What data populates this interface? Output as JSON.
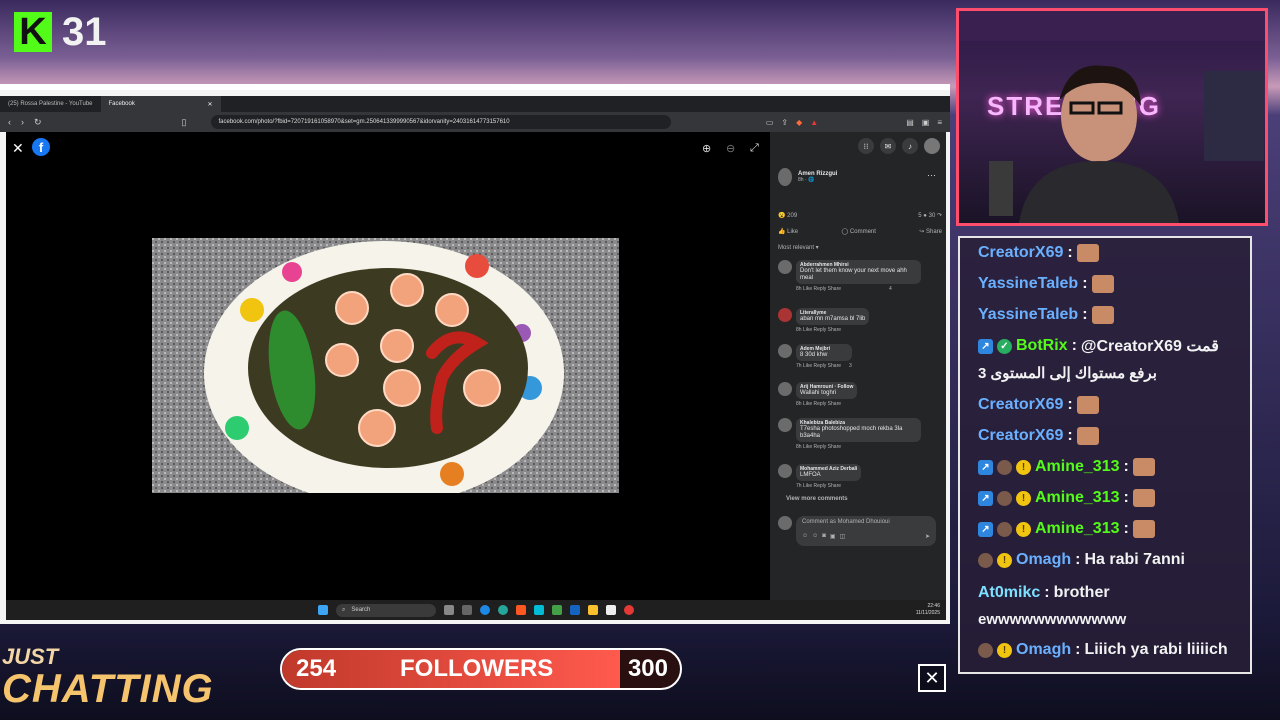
{
  "kick_badge": {
    "logo": "K",
    "number": "31"
  },
  "browser": {
    "tabs": [
      "(25) Rossa Palestine - YouTube",
      "Facebook"
    ],
    "url": "facebook.com/photo/?fbid=720719161058970&set=gm.2506413399990567&idorvanity=24031614773157610"
  },
  "post": {
    "author": "Amen Rizzgui",
    "time": "8h · 🌐",
    "reactions_count": "209",
    "comments_count": "5",
    "shares_count": "30",
    "actions": [
      "Like",
      "Comment",
      "Share"
    ],
    "sort_label": "Most relevant",
    "comments": [
      {
        "name": "Abderrahmen Mhirsi",
        "text": "Don't let them know your next move ahh meal",
        "meta": "8h   Like   Reply   Share",
        "reacts": "4"
      },
      {
        "name": "Literallyme",
        "text": "aban mn m7amsa bl 7lib",
        "meta": "8h   Like   Reply   Share",
        "reacts": ""
      },
      {
        "name": "Adem Mejbri",
        "text": "8 30d khw",
        "meta": "7h   Like   Reply   Share",
        "reacts": "3"
      },
      {
        "name": "Arij Hamrouni · Follow",
        "text": "Wallahi toghri",
        "meta": "8h   Like   Reply   Share",
        "reacts": ""
      },
      {
        "name": "Khalebiza Balebiza",
        "text": "T7esha photoshopped moch rekba 3la b3a4ha",
        "meta": "8h   Like   Reply   Share",
        "reacts": ""
      },
      {
        "name": "Mohammed Aziz Derbali",
        "text": "LMFOA",
        "meta": "7h   Like   Reply   Share",
        "reacts": ""
      }
    ],
    "view_more": "View more comments",
    "comment_placeholder": "Comment as Mohamed Dhouioui"
  },
  "taskbar": {
    "search_label": "Search",
    "time": "22:46",
    "date": "11/11/2025"
  },
  "cam_sign": "STREAMING",
  "chat": [
    {
      "user": "CreatorX69",
      "sep": " : ",
      "message": "",
      "emote": true,
      "badges": []
    },
    {
      "user": "YassineTaleb",
      "sep": " : ",
      "message": "",
      "emote": true,
      "badges": []
    },
    {
      "user": "YassineTaleb",
      "sep": " : ",
      "message": "",
      "emote": true,
      "badges": []
    },
    {
      "user": "BotRix",
      "sep": " : ",
      "message": "@CreatorX69 قمت",
      "emote": false,
      "badges": [
        "blue",
        "green"
      ]
    },
    {
      "user": "",
      "sep": "",
      "message": "برفع مستواك إلى المستوى 3",
      "emote": false,
      "badges": []
    },
    {
      "user": "CreatorX69",
      "sep": " : ",
      "message": "",
      "emote": true,
      "badges": []
    },
    {
      "user": "CreatorX69",
      "sep": " : ",
      "message": "",
      "emote": true,
      "badges": []
    },
    {
      "user": "Amine_313",
      "sep": " : ",
      "message": "",
      "emote": true,
      "badges": [
        "blue",
        "pic",
        "gold"
      ]
    },
    {
      "user": "Amine_313",
      "sep": " : ",
      "message": "",
      "emote": true,
      "badges": [
        "blue",
        "pic",
        "gold"
      ]
    },
    {
      "user": "Amine_313",
      "sep": " : ",
      "message": "",
      "emote": true,
      "badges": [
        "blue",
        "pic",
        "gold"
      ]
    },
    {
      "user": "Omagh",
      "sep": " : ",
      "message": "Ha rabi 7anni",
      "emote": false,
      "badges": [
        "pic",
        "gold"
      ]
    },
    {
      "user": "At0mikc",
      "sep": " : ",
      "message": "brother",
      "emote": false,
      "badges": []
    },
    {
      "user": "",
      "sep": "",
      "message": "ewwwwwwwwwwww",
      "emote": false,
      "badges": []
    },
    {
      "user": "Omagh",
      "sep": " : ",
      "message": "Liiich ya rabi liiiich",
      "emote": false,
      "badges": [
        "pic",
        "gold"
      ]
    }
  ],
  "overlay": {
    "just": "JUST",
    "chatting": "CHATTING",
    "followers_current": "254",
    "followers_label": "FOLLOWERS",
    "followers_goal": "300",
    "followers_progress": 0.85,
    "close_glyph": "✕"
  },
  "colors": {
    "kick_green": "#53fc18",
    "fb_blue": "#1877f2",
    "progress_red": "#ff5a4d"
  }
}
